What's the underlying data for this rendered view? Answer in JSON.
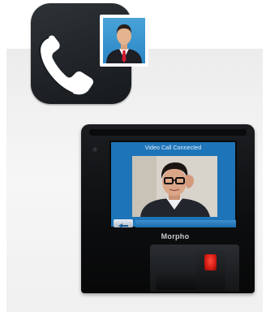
{
  "app_icon": {
    "icon": "video-call-phone-icon",
    "handset_color": "#ffffff",
    "background": "#1f2327",
    "photo_bg": "#3a96d3"
  },
  "device": {
    "screen": {
      "title": "Video Call Connected",
      "back_icon": "back-arrow-icon",
      "accent": "#1e74b8"
    },
    "brand": "Morpho",
    "sensor_color": "#e0261b"
  }
}
